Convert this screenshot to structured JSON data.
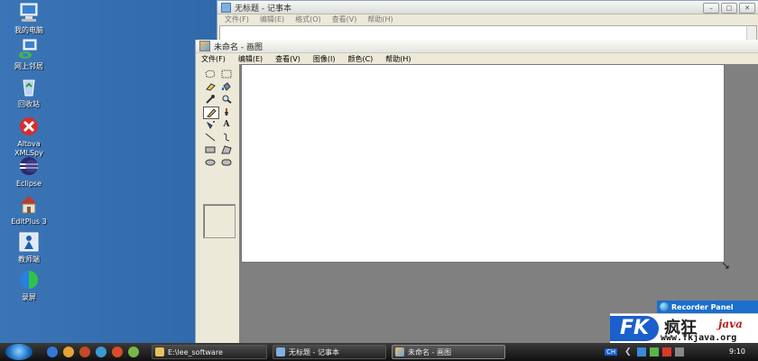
{
  "desktop": {
    "icons": [
      {
        "label": "我的电脑",
        "icon": "my-computer-icon"
      },
      {
        "label": "网上邻居",
        "icon": "network-icon"
      },
      {
        "label": "回收站",
        "icon": "recycle-bin-icon"
      },
      {
        "label": "Altova XMLSpy",
        "icon": "xmlspy-icon"
      },
      {
        "label": "Eclipse",
        "icon": "eclipse-icon"
      },
      {
        "label": "EditPlus 3",
        "icon": "editplus-icon"
      },
      {
        "label": "教师端",
        "icon": "teacher-icon"
      },
      {
        "label": "录屏",
        "icon": "screen-record-icon"
      }
    ]
  },
  "notepad": {
    "title": "无标题 - 记事本",
    "menu": [
      "文件(F)",
      "编辑(E)",
      "格式(O)",
      "查看(V)",
      "帮助(H)"
    ]
  },
  "paint": {
    "title": "未命名 - 画图",
    "menu": [
      "文件(F)",
      "编辑(E)",
      "查看(V)",
      "图像(I)",
      "颜色(C)",
      "帮助(H)"
    ],
    "tools": [
      "free-select",
      "rect-select",
      "eraser",
      "fill",
      "color-picker",
      "magnifier",
      "pencil",
      "brush",
      "airbrush",
      "text",
      "line",
      "curve",
      "rectangle",
      "polygon",
      "ellipse",
      "rounded-rectangle"
    ],
    "selected_tool": "pencil"
  },
  "recorder": {
    "title": "Recorder Panel"
  },
  "fk_banner": {
    "logo": "FK",
    "chinese": "疯狂",
    "java": "java",
    "url": "www.fkjava.org"
  },
  "taskbar": {
    "tasks": [
      {
        "label": "E:\\lee_software",
        "icon": "folder-icon"
      },
      {
        "label": "无标题 - 记事本",
        "icon": "notepad-icon"
      },
      {
        "label": "未命名 - 画图",
        "icon": "paint-icon"
      }
    ],
    "tray_lang": "CH",
    "clock": "9:10"
  },
  "colors": {
    "desktop": "#2f6aa8",
    "workspace": "#808080",
    "recorder": "#1a6fcc",
    "fk_blue": "#1a5fcc",
    "fk_red": "#b41e1e"
  }
}
